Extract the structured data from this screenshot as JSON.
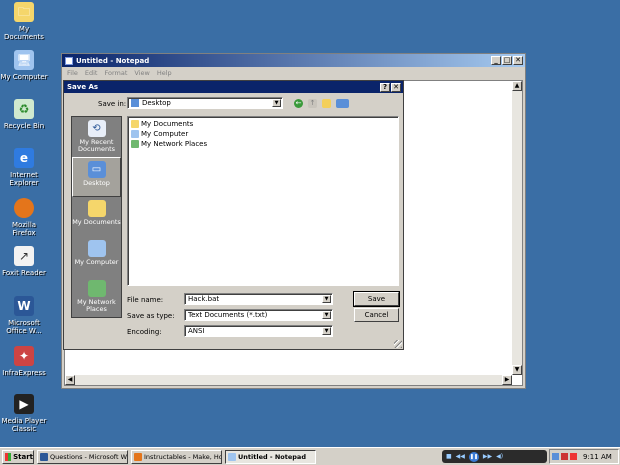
{
  "desktop": {
    "icons": [
      {
        "label": "My Documents",
        "icon": "my-documents-icon"
      },
      {
        "label": "My Computer",
        "icon": "my-computer-icon"
      },
      {
        "label": "Recycle Bin",
        "icon": "recycle-bin-icon"
      },
      {
        "label": "Internet Explorer",
        "icon": "internet-explorer-icon"
      },
      {
        "label": "Mozilla Firefox",
        "icon": "firefox-icon"
      },
      {
        "label": "Foxit Reader",
        "icon": "foxit-reader-icon"
      },
      {
        "label": "Microsoft Office W...",
        "icon": "word-icon"
      },
      {
        "label": "InfraExpress",
        "icon": "infraexpress-icon"
      },
      {
        "label": "Media Player Classic",
        "icon": "media-player-icon"
      }
    ]
  },
  "notepad": {
    "title": "Untitled - Notepad",
    "menu": [
      "File",
      "Edit",
      "Format",
      "View",
      "Help"
    ],
    "minimize": "_",
    "maximize": "□",
    "close": "✕"
  },
  "save_as": {
    "title": "Save As",
    "help": "?",
    "close": "✕",
    "save_in_label": "Save in:",
    "save_in_value": "Desktop",
    "places": [
      {
        "label": "My Recent Documents",
        "icon": "recent-documents-icon"
      },
      {
        "label": "Desktop",
        "icon": "desktop-icon",
        "selected": true
      },
      {
        "label": "My Documents",
        "icon": "my-documents-icon"
      },
      {
        "label": "My Computer",
        "icon": "my-computer-icon"
      },
      {
        "label": "My Network Places",
        "icon": "network-places-icon"
      }
    ],
    "files": [
      "My Documents",
      "My Computer",
      "My Network Places"
    ],
    "file_name_label": "File name:",
    "file_name_value": "Hack.bat",
    "save_type_label": "Save as type:",
    "save_type_value": "Text Documents (*.txt)",
    "encoding_label": "Encoding:",
    "encoding_value": "ANSI",
    "save_button": "Save",
    "cancel_button": "Cancel"
  },
  "taskbar": {
    "start": "Start",
    "tasks": [
      {
        "label": "Questions - Microsoft Word",
        "active": false
      },
      {
        "label": "Instructables - Make, Ho...",
        "active": false
      },
      {
        "label": "Untitled - Notepad",
        "active": true
      }
    ],
    "clock": "9:11 AM"
  },
  "colors": {
    "desktop": "#3a6ea5",
    "title_active": "#0a246a",
    "chrome": "#d4d0c8"
  }
}
